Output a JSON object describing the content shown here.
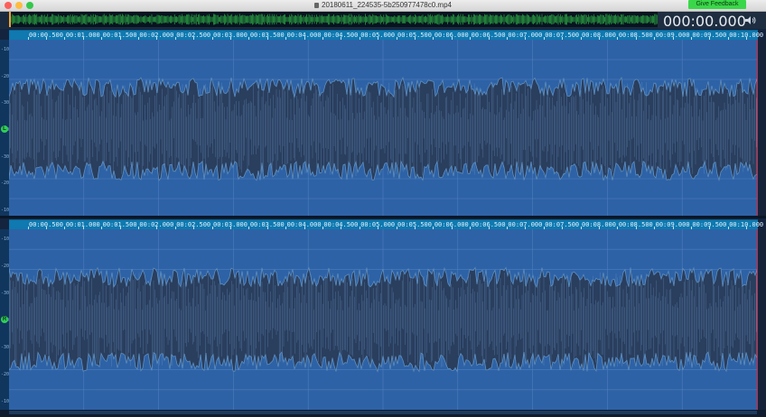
{
  "window": {
    "title": "20180611_224535-5b250977478c0.mp4",
    "feedback_label": "Give Feedback"
  },
  "transport": {
    "timecode": "000:00.000"
  },
  "ruler": {
    "labels": [
      "00:00.500",
      "00:01.000",
      "00:01.500",
      "00:02.000",
      "00:02.500",
      "00:03.000",
      "00:03.500",
      "00:04.000",
      "00:04.500",
      "00:05.000",
      "00:05.500",
      "00:06.000",
      "00:06.500",
      "00:07.000",
      "00:07.500",
      "00:08.000",
      "00:08.500",
      "00:09.000",
      "00:09.500",
      "00:10.000"
    ]
  },
  "channels": [
    {
      "badge": "L",
      "scale": [
        "-10",
        "-20",
        "-30",
        "-40",
        "-30",
        "-20",
        "-10"
      ]
    },
    {
      "badge": "R",
      "scale": [
        "-10",
        "-20",
        "-30",
        "-40",
        "-30",
        "-20",
        "-10"
      ]
    }
  ],
  "colors": {
    "waveform_fill": "#2a3e5e",
    "waveform_stroke": "#5e8fbf",
    "channel_bg": "#2e62a6",
    "ruler_bg": "#0f79b0",
    "overview_wave": "#34c84a",
    "cursor": "#d8243a"
  }
}
